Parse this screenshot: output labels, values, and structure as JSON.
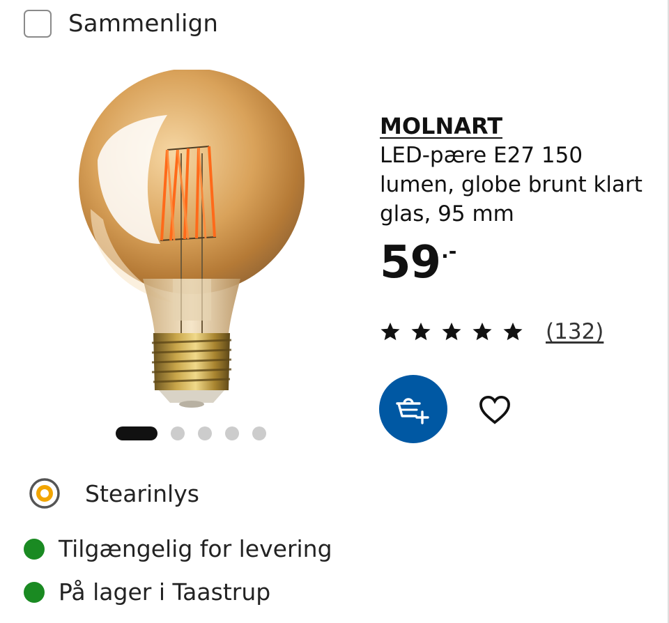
{
  "compare": {
    "label": "Sammenlign",
    "checked": false
  },
  "product": {
    "name": "MOLNART",
    "description": "LED-pære E27 150 lumen, globe brunt klart glas, 95 mm",
    "price": "59",
    "price_suffix": ".-",
    "image_icon": "led-globe-bulb"
  },
  "gallery": {
    "count": 5,
    "active_index": 0
  },
  "rating": {
    "stars": 5,
    "review_count": "(132)"
  },
  "actions": {
    "add_to_cart_icon": "basket-plus-icon",
    "favourite_icon": "heart-outline-icon"
  },
  "style": {
    "label": "Stearinlys"
  },
  "availability": [
    {
      "label": "Tilgængelig for levering",
      "status_color": "#1a8a22"
    },
    {
      "label": "På lager i Taastrup",
      "status_color": "#1a8a22"
    }
  ],
  "colors": {
    "accent_blue": "#0058a3",
    "status_green": "#1a8a22"
  }
}
